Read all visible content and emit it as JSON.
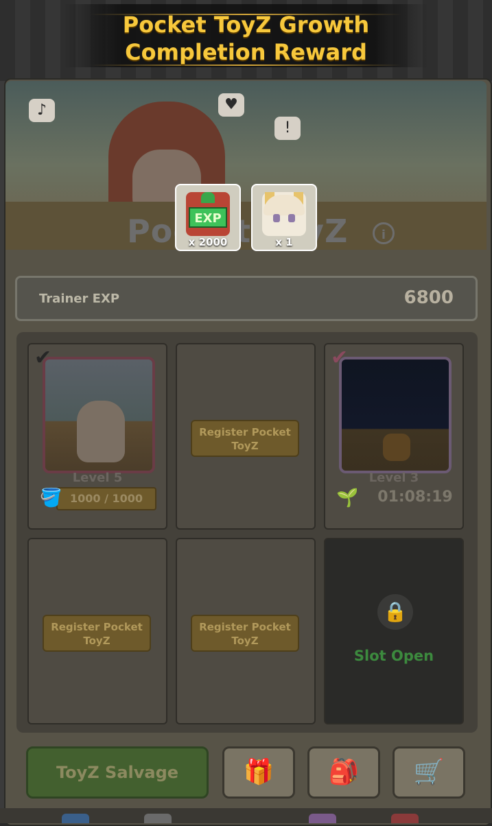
{
  "header": {
    "title_line1": "Pocket ToyZ Growth",
    "title_line2": "Completion Reward"
  },
  "hero": {
    "brand_text": "Pocket ToyZ",
    "icons": [
      "music-note-icon",
      "heart-icon",
      "exclamation-icon"
    ]
  },
  "rewards": [
    {
      "name": "EXP",
      "quantity": "x 2000",
      "icon": "exp-box-icon"
    },
    {
      "name": "ToyZ",
      "quantity": "x 1",
      "icon": "toyz-portrait-icon"
    }
  ],
  "trainer_exp": {
    "label": "Trainer EXP",
    "value": "6800"
  },
  "slots": [
    {
      "state": "growing-complete",
      "level": "Level 5",
      "water": "1000 / 1000"
    },
    {
      "state": "empty",
      "button": "Register Pocket ToyZ"
    },
    {
      "state": "growing",
      "level": "Level 3",
      "timer": "01:08:19"
    },
    {
      "state": "empty",
      "button": "Register Pocket ToyZ"
    },
    {
      "state": "empty",
      "button": "Register Pocket ToyZ"
    },
    {
      "state": "locked",
      "label": "Slot Open"
    }
  ],
  "bottom": {
    "salvage_label": "ToyZ Salvage",
    "buttons": [
      "gift-box-icon",
      "backpack-icon",
      "shop-cart-icon"
    ]
  },
  "colors": {
    "title_gold": "#f7c83c",
    "slot_open_green": "#3c8a3e",
    "salvage_green": "#43602f"
  }
}
